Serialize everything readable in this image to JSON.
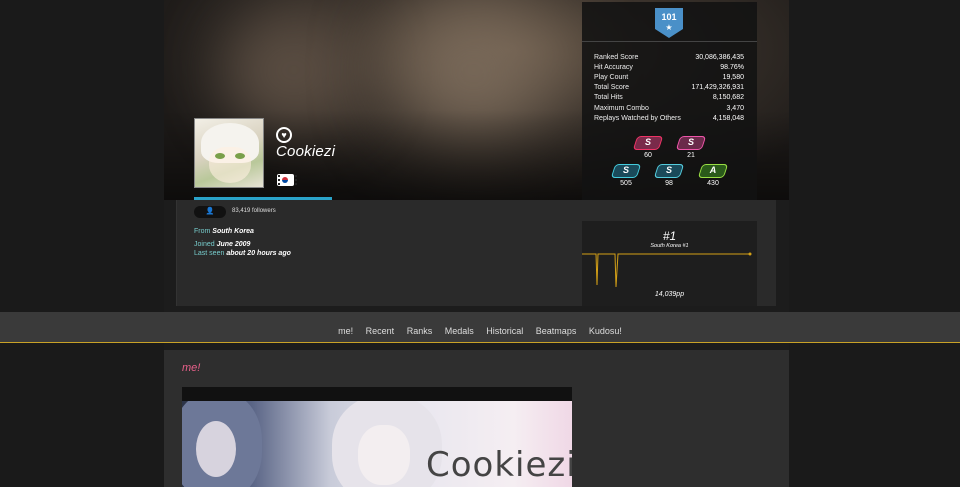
{
  "profile": {
    "username": "Cookiezi",
    "level": "101",
    "followers": "83,419 followers",
    "from_key": "From",
    "from_val": "South Korea",
    "joined_key": "Joined",
    "joined_val": "June 2009",
    "lastseen_key": "Last seen",
    "lastseen_val": "about 20 hours ago"
  },
  "stats": [
    {
      "label": "Ranked Score",
      "value": "30,086,386,435"
    },
    {
      "label": "Hit Accuracy",
      "value": "98.76%"
    },
    {
      "label": "Play Count",
      "value": "19,580"
    },
    {
      "label": "Total Score",
      "value": "171,429,326,931"
    },
    {
      "label": "Total Hits",
      "value": "8,150,682"
    },
    {
      "label": "Maximum Combo",
      "value": "3,470"
    },
    {
      "label": "Replays Watched by Others",
      "value": "4,158,048"
    }
  ],
  "grades": [
    {
      "letter": "S",
      "count": "60"
    },
    {
      "letter": "S",
      "count": "21"
    },
    {
      "letter": "S",
      "count": "505"
    },
    {
      "letter": "S",
      "count": "98"
    },
    {
      "letter": "A",
      "count": "430"
    }
  ],
  "rank": {
    "global": "#1",
    "country": "South Korea #1",
    "pp": "14,039pp"
  },
  "nav": [
    "me!",
    "Recent",
    "Ranks",
    "Medals",
    "Historical",
    "Beatmaps",
    "Kudosu!"
  ],
  "me_section": {
    "title": "me!",
    "image_text": "Cookiezi"
  },
  "colors": {
    "accent_blue": "#2aa3c9",
    "nav_underline": "#c9a227",
    "me_title": "#e8608a",
    "rank_line": "#d4a017"
  }
}
